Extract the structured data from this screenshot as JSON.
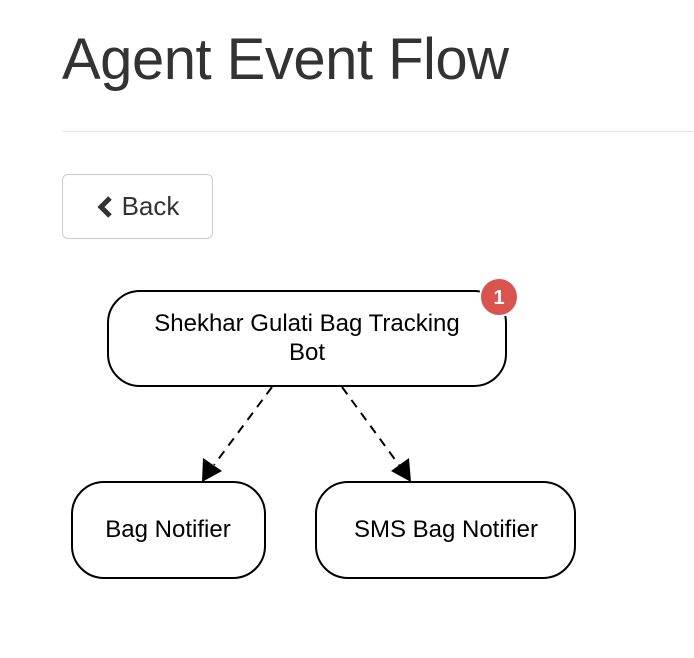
{
  "page": {
    "title": "Agent Event Flow"
  },
  "toolbar": {
    "back_label": "Back",
    "back_icon": "chevron-left-icon"
  },
  "flow": {
    "root": {
      "label_line1": "Shekhar Gulati Bag Tracking",
      "label_line2": "Bot",
      "badge_count": "1",
      "badge_color": "#d9534f"
    },
    "children": [
      {
        "label": "Bag Notifier"
      },
      {
        "label": "SMS Bag Notifier"
      }
    ],
    "edge_style": "dashed"
  }
}
